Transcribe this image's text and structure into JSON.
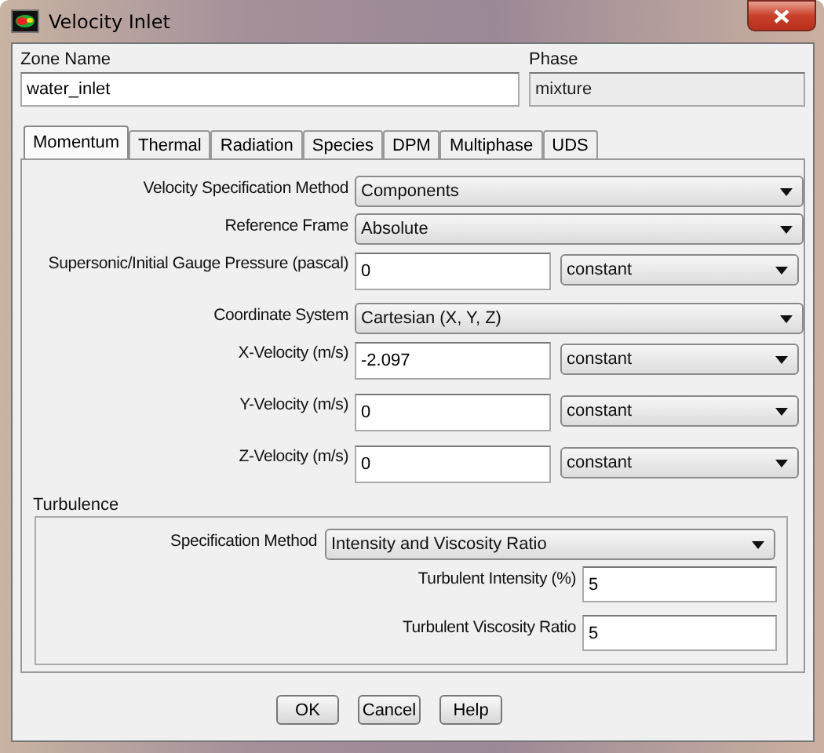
{
  "window": {
    "title": "Velocity Inlet"
  },
  "zone_name": {
    "label": "Zone Name",
    "value": "water_inlet"
  },
  "phase": {
    "label": "Phase",
    "value": "mixture",
    "disabled": true
  },
  "tabs": [
    {
      "label": "Momentum",
      "selected": true
    },
    {
      "label": "Thermal",
      "selected": false
    },
    {
      "label": "Radiation",
      "selected": false
    },
    {
      "label": "Species",
      "selected": false
    },
    {
      "label": "DPM",
      "selected": false
    },
    {
      "label": "Multiphase",
      "selected": false
    },
    {
      "label": "UDS",
      "selected": false
    }
  ],
  "momentum": [
    {
      "kind": "select",
      "label": "Velocity Specification Method",
      "value": "Components"
    },
    {
      "kind": "select",
      "label": "Reference Frame",
      "value": "Absolute"
    },
    {
      "kind": "value_profile",
      "label": "Supersonic/Initial Gauge Pressure (pascal)",
      "value": "0",
      "profile": "constant"
    },
    {
      "kind": "select",
      "label": "Coordinate System",
      "value": "Cartesian (X, Y, Z)"
    },
    {
      "kind": "value_profile",
      "label": "X-Velocity (m/s)",
      "value": "-2.097",
      "profile": "constant"
    },
    {
      "kind": "value_profile",
      "label": "Y-Velocity (m/s)",
      "value": "0",
      "profile": "constant"
    },
    {
      "kind": "value_profile",
      "label": "Z-Velocity (m/s)",
      "value": "0",
      "profile": "constant"
    }
  ],
  "turbulence": {
    "title": "Turbulence",
    "rows": [
      {
        "kind": "select",
        "label": "Specification Method",
        "value": "Intensity and Viscosity Ratio"
      },
      {
        "kind": "input",
        "label": "Turbulent Intensity (%)",
        "value": "5"
      },
      {
        "kind": "input",
        "label": "Turbulent Viscosity Ratio",
        "value": "5"
      }
    ]
  },
  "buttons": [
    "OK",
    "Cancel",
    "Help"
  ]
}
